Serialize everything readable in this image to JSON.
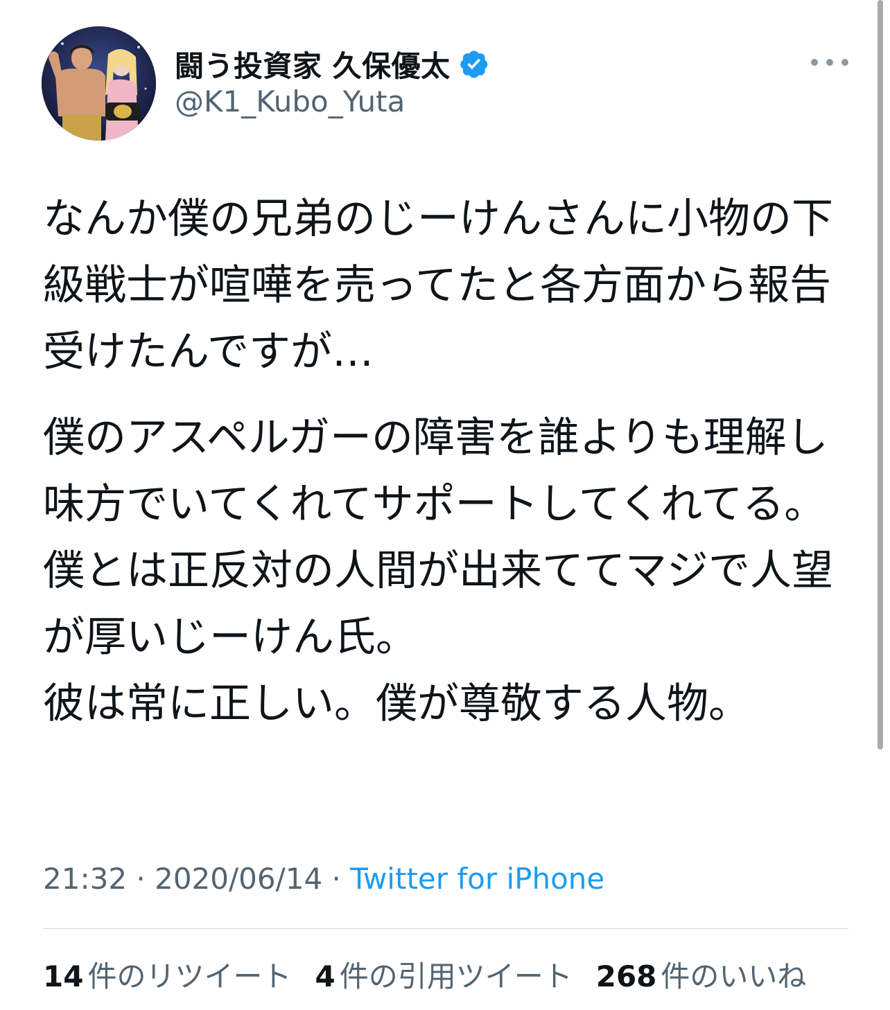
{
  "header": {
    "display_name": "闘う投資家 久保優太",
    "handle": "@K1_Kubo_Yuta",
    "verified_icon": "verified-badge-icon",
    "more_icon": "more-horizontal-icon"
  },
  "tweet": {
    "paragraph_1": "なんか僕の兄弟のじーけんさんに小物の下級戦士が喧嘩を売ってたと各方面から報告受けたんですが…",
    "paragraph_2": "僕のアスペルガーの障害を誰よりも理解し味方でいてくれてサポートしてくれてる。\n僕とは正反対の人間が出来ててマジで人望が厚いじーけん氏。\n彼は常に正しい。僕が尊敬する人物。"
  },
  "meta": {
    "time": "21:32",
    "separator_1": " · ",
    "date": "2020/06/14",
    "separator_2": " · ",
    "source": "Twitter for iPhone"
  },
  "stats": {
    "retweets_count": "14",
    "retweets_label": "件のリツイート",
    "quotes_count": "4",
    "quotes_label": "件の引用ツイート",
    "likes_count": "268",
    "likes_label": "件のいいね"
  },
  "colors": {
    "text_primary": "#0f1419",
    "text_secondary": "#536471",
    "link": "#1d9bf0",
    "verified": "#1d9bf0",
    "divider": "#cfd9de"
  }
}
